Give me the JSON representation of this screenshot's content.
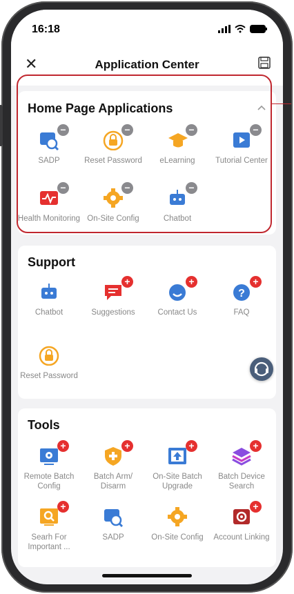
{
  "status": {
    "time": "16:18"
  },
  "header": {
    "title": "Application Center"
  },
  "home": {
    "title": "Home Page Applications",
    "apps": [
      {
        "label": "SADP",
        "icon": "search-device-icon",
        "color": "#3a7bd5"
      },
      {
        "label": "Reset Password",
        "icon": "lock-reset-icon",
        "color": "#f5a623"
      },
      {
        "label": "eLearning",
        "icon": "graduation-cap-icon",
        "color": "#f5a623"
      },
      {
        "label": "Tutorial Center",
        "icon": "tutorial-play-icon",
        "color": "#3a7bd5"
      },
      {
        "label": "Health Monitoring",
        "icon": "health-monitor-icon",
        "color": "#e5302f"
      },
      {
        "label": "On-Site Config",
        "icon": "gear-config-icon",
        "color": "#f5a623"
      },
      {
        "label": "Chatbot",
        "icon": "robot-icon",
        "color": "#3a7bd5"
      }
    ]
  },
  "support": {
    "title": "Support",
    "apps": [
      {
        "label": "Chatbot",
        "icon": "robot-icon",
        "color": "#3a7bd5"
      },
      {
        "label": "Suggestions",
        "icon": "chat-bubble-icon",
        "color": "#e5302f"
      },
      {
        "label": "Contact Us",
        "icon": "headset-icon",
        "color": "#3a7bd5"
      },
      {
        "label": "FAQ",
        "icon": "question-icon",
        "color": "#3a7bd5"
      },
      {
        "label": "Reset Password",
        "icon": "lock-reset-icon",
        "color": "#f5a623"
      }
    ]
  },
  "tools": {
    "title": "Tools",
    "apps": [
      {
        "label": "Remote Batch Config",
        "icon": "remote-config-icon",
        "color": "#3a7bd5"
      },
      {
        "label": "Batch Arm/ Disarm",
        "icon": "shield-icon",
        "color": "#f5a623"
      },
      {
        "label": "On-Site Batch Upgrade",
        "icon": "upgrade-icon",
        "color": "#3a7bd5"
      },
      {
        "label": "Batch Device Search",
        "icon": "layers-icon",
        "color": "#8a4de0"
      },
      {
        "label": "Searh For Important ...",
        "icon": "search-box-icon",
        "color": "#f5a623"
      },
      {
        "label": "SADP",
        "icon": "search-device-icon",
        "color": "#3a7bd5"
      },
      {
        "label": "On-Site Config",
        "icon": "gear-config-icon",
        "color": "#f5a623"
      },
      {
        "label": "Account Linking",
        "icon": "link-device-icon",
        "color": "#d03030"
      }
    ]
  },
  "colors": {
    "accent_red": "#e5302f",
    "highlight": "#c0262e",
    "blue": "#3a7bd5",
    "orange": "#f5a623"
  }
}
